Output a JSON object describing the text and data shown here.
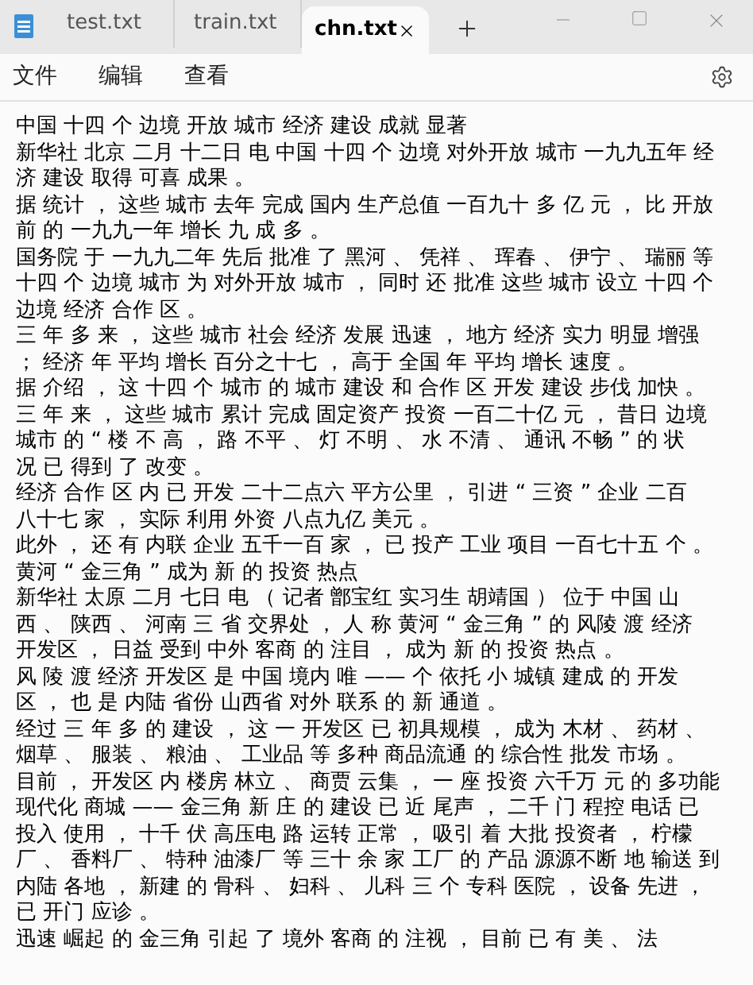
{
  "tabs": [
    {
      "label": "test.txt",
      "selected": false
    },
    {
      "label": "train.txt",
      "selected": false
    },
    {
      "label": "chn.txt",
      "selected": true
    }
  ],
  "menu": [
    "文件",
    "编辑",
    "查看"
  ],
  "lines": [
    "中国 十四 个 边境 开放 城市 经济 建设 成就 显著",
    "新华社 北京 二月 十二日 电 中国 十四 个 边境 对外开放 城市 一九九五年 经",
    "济 建设 取得 可喜 成果 。",
    "据 统计 ， 这些 城市 去年 完成 国内 生产总值 一百九十 多 亿 元 ， 比 开放",
    "前 的 一九九一年 增长 九 成 多 。",
    "国务院 于 一九九二年 先后 批准 了 黑河 、 凭祥 、 珲春 、 伊宁 、 瑞丽 等",
    "十四 个 边境 城市 为 对外开放 城市 ， 同时 还 批准 这些 城市 设立 十四 个",
    "边境 经济 合作 区 。",
    "三 年 多 来 ， 这些 城市 社会 经济 发展 迅速 ， 地方 经济 实力 明显 增强",
    "； 经济 年 平均 增长 百分之十七 ， 高于 全国 年 平均 增长 速度 。",
    "据 介绍 ， 这 十四 个 城市 的 城市 建设 和 合作 区 开发 建设 步伐 加快 。",
    "三 年 来 ， 这些 城市 累计 完成 固定资产 投资 一百二十亿 元 ， 昔日 边境",
    "城市 的 “ 楼 不 高 ， 路 不平 、 灯 不明 、 水 不清 、 通讯 不畅 ” 的 状",
    "况 已 得到 了 改变 。",
    "经济 合作 区 内 已 开发 二十二点六 平方公里 ， 引进 “ 三资 ” 企业 二百",
    "八十七 家 ， 实际 利用 外资 八点九亿 美元 。",
    "此外 ， 还 有 内联 企业 五千一百 家 ， 已 投产 工业 项目 一百七十五 个 。",
    "黄河 “ 金三角 ” 成为 新 的 投资 热点",
    "新华社 太原 二月 七日 电 （ 记者 鄫宝红 实习生 胡靖国 ） 位于 中国 山",
    "西 、 陕西 、 河南 三 省 交界处 ， 人 称 黄河 “ 金三角 ” 的 风陵 渡 经济",
    "开发区 ， 日益 受到 中外 客商 的 注目 ， 成为 新 的 投资 热点 。",
    "风 陵 渡 经济 开发区 是 中国 境内 唯 —— 个 依托 小 城镇 建成 的 开发",
    "区 ， 也 是 内陆 省份 山西省 对外 联系 的 新 通道 。",
    "经过 三 年 多 的 建设 ， 这 一 开发区 已 初具规模 ， 成为 木材 、 药材 、",
    "烟草 、 服装 、 粮油 、 工业品 等 多种 商品流通 的 综合性 批发 市场 。",
    "目前 ， 开发区 内 楼房 林立 、 商贾 云集 ， 一 座 投资 六千万 元 的 多功能",
    "现代化 商城 —— 金三角 新 庄 的 建设 已 近 尾声 ， 二千 门 程控 电话 已",
    "投入 使用 ， 十千 伏 高压电 路 运转 正常 ， 吸引 着 大批 投资者 ， 柠檬",
    "厂 、 香料厂 、 特种 油漆厂 等 三十 余 家 工厂 的 产品 源源不断 地 输送 到",
    "内陆 各地 ， 新建 的 骨科 、 妇科 、 儿科 三 个 专科 医院 ， 设备 先进 ，",
    "已 开门 应诊 。",
    "迅速 崛起 的 金三角 引起 了 境外 客商 的 注视 ， 目前 已 有 美 、 法"
  ]
}
